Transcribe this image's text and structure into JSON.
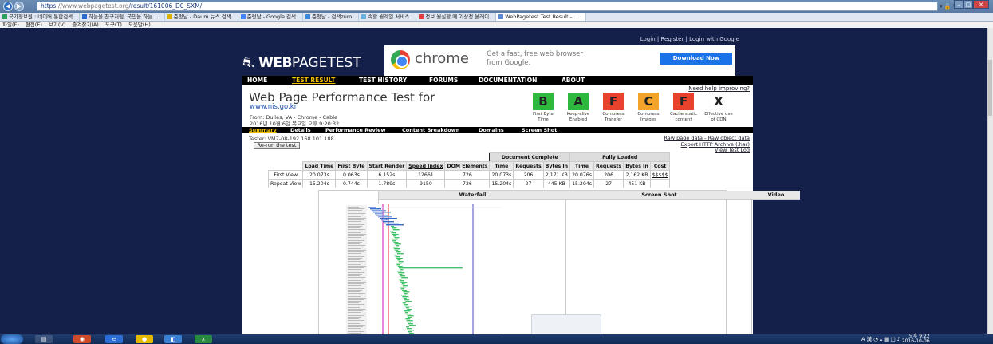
{
  "browser": {
    "url_scheme": "https",
    "url_host": "www.webpagetest.org",
    "url_path": "/result/161006_D0_SXM/",
    "favorites": [
      {
        "label": "국가정보원 : 네이버 통합검색",
        "active": false
      },
      {
        "label": "하늘을 친구처럼, 국민을 하늘…",
        "active": false
      },
      {
        "label": "준렁남 - Daum 뉴스 검색",
        "active": false
      },
      {
        "label": "준렁남 - Google 검색",
        "active": false
      },
      {
        "label": "준렁남 - 검색zum",
        "active": false
      },
      {
        "label": "속할 월례일 서비스",
        "active": false
      },
      {
        "label": "정보 월실할 때 기상정 올레이",
        "active": false
      },
      {
        "label": "WebPagetest Test Result - …",
        "active": true
      }
    ],
    "menu": [
      "파일(F)",
      "편집(E)",
      "보기(V)",
      "즐겨찾기(A)",
      "도구(T)",
      "도움말(H)"
    ]
  },
  "top_links": {
    "login": "Login",
    "register": "Register",
    "login_google": "Login with Google",
    "sep": "|"
  },
  "logo": {
    "bold": "WEB",
    "thin": "PAGETEST"
  },
  "ad": {
    "brand": "chrome",
    "text": "Get a fast, free web browser from Google.",
    "button": "Download Now"
  },
  "main_nav": [
    "HOME",
    "TEST RESULT",
    "TEST HISTORY",
    "FORUMS",
    "DOCUMENTATION",
    "ABOUT"
  ],
  "main_nav_current": 1,
  "help_link": "Need help improving?",
  "title": "Web Page Performance Test for",
  "site": "www.nis.go.kr",
  "from": "From: Dulles, VA - Chrome - Cable",
  "date": "2016년 10월 6일 목요일 오후 9:20:32",
  "grades": [
    {
      "grade": "B",
      "label": "First Byte Time",
      "color": "#2eb83d"
    },
    {
      "grade": "A",
      "label": "Keep-alive Enabled",
      "color": "#2eb83d"
    },
    {
      "grade": "F",
      "label": "Compress Transfer",
      "color": "#e8412c"
    },
    {
      "grade": "C",
      "label": "Compress Images",
      "color": "#f2a42a"
    },
    {
      "grade": "F",
      "label": "Cache static content",
      "color": "#e8412c"
    },
    {
      "grade": "X",
      "label": "Effective use of CDN",
      "color": "#ffffff"
    }
  ],
  "sub_nav": [
    "Summary",
    "Details",
    "Performance Review",
    "Content Breakdown",
    "Domains",
    "Screen Shot"
  ],
  "tester": "Tester: VM7-08-192.168.101.188",
  "rerun": "Re-run the test",
  "right_links": [
    "Raw page data - Raw object data",
    "Export HTTP Archive (.har)",
    "View Test Log"
  ],
  "table": {
    "group_doc": "Document Complete",
    "group_full": "Fully Loaded",
    "headers": [
      "Load Time",
      "First Byte",
      "Start Render",
      "Speed Index",
      "DOM Elements",
      "Time",
      "Requests",
      "Bytes In",
      "Time",
      "Requests",
      "Bytes In",
      "Cost"
    ],
    "rows": [
      {
        "label": "First View",
        "cells": [
          "20.073s",
          "0.063s",
          "6.152s",
          "12661",
          "726",
          "20.073s",
          "206",
          "2,171 KB",
          "20.076s",
          "206",
          "2,162 KB",
          "$$$$$"
        ]
      },
      {
        "label": "Repeat View",
        "cells": [
          "15.204s",
          "0.744s",
          "1.789s",
          "9150",
          "726",
          "15.204s",
          "27",
          "445 KB",
          "15.204s",
          "27",
          "451 KB",
          ""
        ]
      }
    ]
  },
  "panels": {
    "waterfall": "Waterfall",
    "screenshot": "Screen Shot",
    "video": "Video"
  },
  "taskbar": {
    "time": "오후 9:22",
    "date": "2016-10-06",
    "lang": "A 漢"
  }
}
